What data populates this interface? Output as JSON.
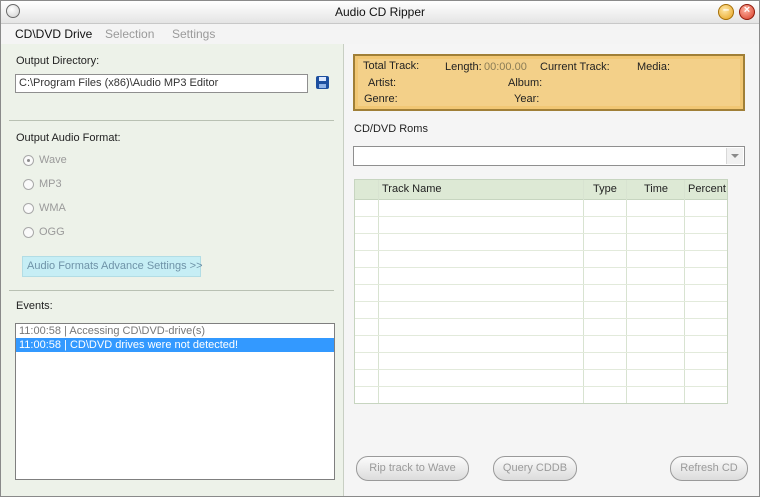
{
  "window": {
    "title": "Audio CD Ripper"
  },
  "menu": {
    "items": [
      "CD\\DVD Drive",
      "Selection",
      "Settings"
    ]
  },
  "left": {
    "output_dir_label": "Output Directory:",
    "output_dir_value": "C:\\Program Files (x86)\\Audio MP3 Editor",
    "format_label": "Output Audio Format:",
    "formats": [
      "Wave",
      "MP3",
      "WMA",
      "OGG"
    ],
    "selected_format": "Wave",
    "advanced_button": "Audio Formats Advance Settings >>",
    "events_label": "Events:",
    "events": [
      "11:00:58 | Accessing CD\\DVD-drive(s)",
      "11:00:58 | CD\\DVD drives were not detected!"
    ],
    "selected_event_index": 1
  },
  "info": {
    "total_track_label": "Total Track:",
    "length_label": "Length:",
    "length_value": "00:00.00",
    "current_track_label": "Current Track:",
    "media_label": "Media:",
    "artist_label": "Artist:",
    "album_label": "Album:",
    "genre_label": "Genre:",
    "year_label": "Year:"
  },
  "roms": {
    "label": "CD/DVD Roms",
    "value": ""
  },
  "table": {
    "columns": [
      "Track Name",
      "Type",
      "Time",
      "Percent"
    ],
    "rows": []
  },
  "buttons": {
    "rip": "Rip track to Wave",
    "query": "Query CDDB",
    "refresh": "Refresh CD"
  },
  "colors": {
    "info_panel": "#f1c774",
    "selection": "#3399ff",
    "advanced_button": "#c6eef5",
    "left_pane": "#edf2e9"
  }
}
